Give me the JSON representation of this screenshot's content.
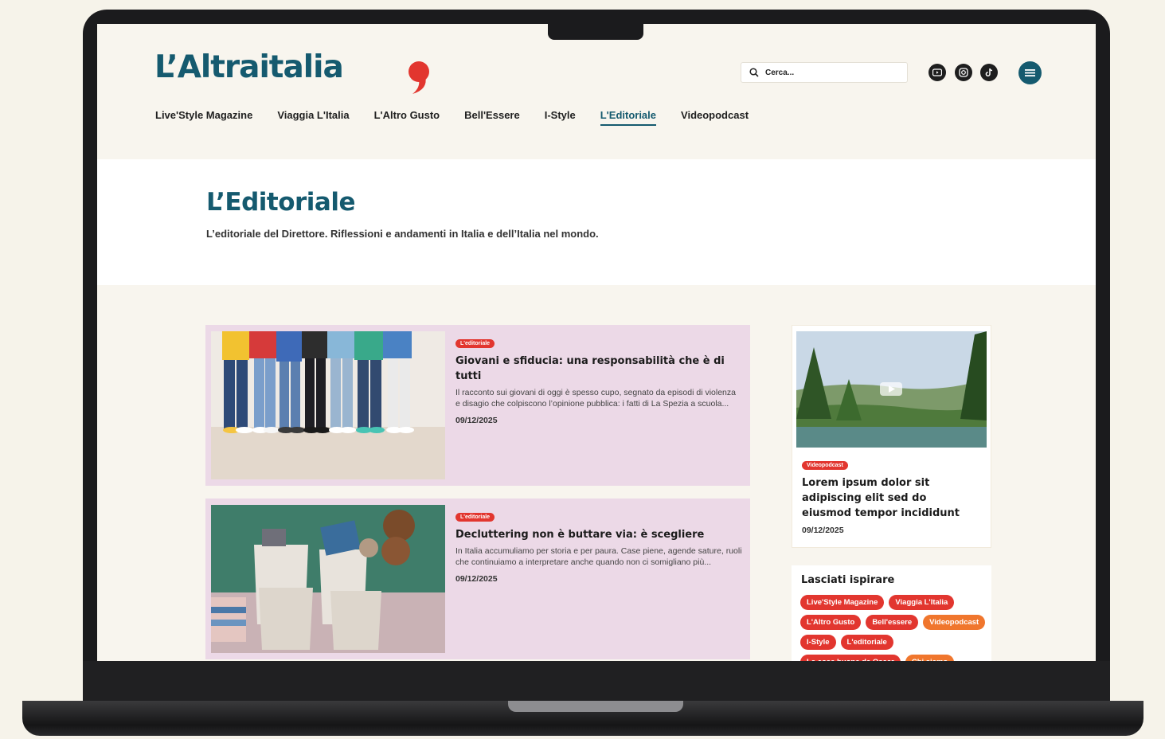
{
  "brand": {
    "logo": "L’Altraitalia",
    "accent": "#155a6f",
    "red": "#e2362f",
    "orange": "#f0762d"
  },
  "search": {
    "placeholder": "Cerca..."
  },
  "social": [
    "youtube-icon",
    "instagram-icon",
    "tiktok-icon"
  ],
  "nav": [
    {
      "label": "Live'Style Magazine",
      "active": false
    },
    {
      "label": "Viaggia L'Italia",
      "active": false
    },
    {
      "label": "L'Altro Gusto",
      "active": false
    },
    {
      "label": "Bell'Essere",
      "active": false
    },
    {
      "label": "I-Style",
      "active": false
    },
    {
      "label": "L'Editoriale",
      "active": true
    },
    {
      "label": "Videopodcast",
      "active": false
    }
  ],
  "hero": {
    "title": "L’Editoriale",
    "subtitle": "L’editoriale del Direttore. Riflessioni e andamenti in Italia e dell’Italia nel mondo."
  },
  "articles": [
    {
      "tag": "L'editoriale",
      "title": "Giovani e sfiducia: una responsabilità che è di tutti",
      "excerpt": "Il racconto sui giovani di oggi è spesso cupo, segnato da episodi di violenza e disagio che colpiscono l’opinione pubblica: i fatti di La Spezia a scuola...",
      "date": "09/12/2025"
    },
    {
      "tag": "L'editoriale",
      "title": "Decluttering non è buttare via: è scegliere",
      "excerpt": "In Italia accumuliamo per storia e per paura. Case piene, agende sature, ruoli che continuiamo a interpretare anche quando non ci somigliano più...",
      "date": "09/12/2025"
    }
  ],
  "sidebar_video": {
    "tag": "Videopodcast",
    "title": "Lorem ipsum dolor sit adipiscing elit sed do eiusmod tempor incididunt",
    "date": "09/12/2025"
  },
  "inspire": {
    "title": "Lasciati ispirare",
    "chips": [
      {
        "label": "Live'Style Magazine",
        "color": "#e2362f"
      },
      {
        "label": "Viaggia L'Italia",
        "color": "#e2362f"
      },
      {
        "label": "L'Altro Gusto",
        "color": "#e2362f"
      },
      {
        "label": "Bell'essere",
        "color": "#e2362f"
      },
      {
        "label": "Videopodcast",
        "color": "#f0762d"
      },
      {
        "label": "I-Style",
        "color": "#e2362f"
      },
      {
        "label": "L'editoriale",
        "color": "#e2362f"
      },
      {
        "label": "Le cose buone da Oscar",
        "color": "#e2362f"
      },
      {
        "label": "Chi siamo",
        "color": "#f0762d"
      }
    ]
  }
}
